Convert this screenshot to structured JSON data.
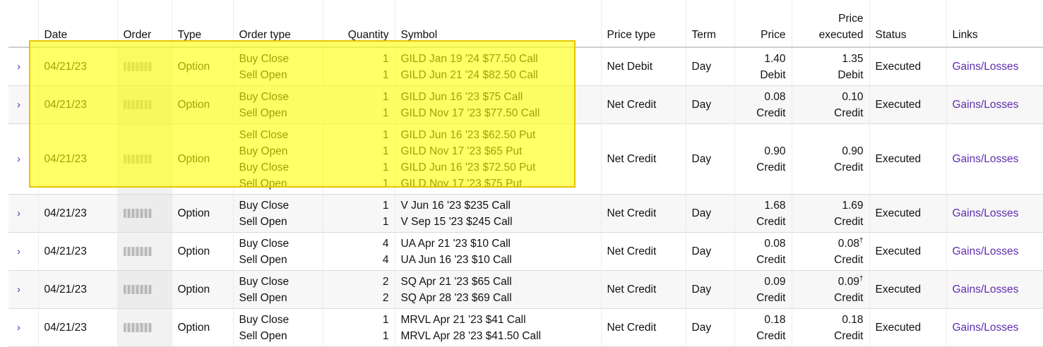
{
  "columns": {
    "date": "Date",
    "order": "Order",
    "type": "Type",
    "order_type": "Order type",
    "quantity": "Quantity",
    "symbol": "Symbol",
    "price_type": "Price type",
    "term": "Term",
    "price": "Price",
    "price_executed_1": "Price",
    "price_executed_2": "executed",
    "status": "Status",
    "links": "Links"
  },
  "expand_glyph": "›",
  "rows": [
    {
      "date": "04/21/23",
      "type": "Option",
      "legs": [
        {
          "order_type": "Buy Close",
          "qty": "1",
          "symbol": "GILD Jan 19 '24 $77.50 Call"
        },
        {
          "order_type": "Sell Open",
          "qty": "1",
          "symbol": "GILD Jun 21 '24 $82.50 Call"
        }
      ],
      "price_type": "Net Debit",
      "term": "Day",
      "price": "1.40",
      "price_unit": "Debit",
      "price_exec": "1.35",
      "price_exec_mark": "",
      "price_exec_unit": "Debit",
      "status": "Executed",
      "link": "Gains/Losses"
    },
    {
      "date": "04/21/23",
      "type": "Option",
      "legs": [
        {
          "order_type": "Buy Close",
          "qty": "1",
          "symbol": "GILD Jun 16 '23 $75 Call"
        },
        {
          "order_type": "Sell Open",
          "qty": "1",
          "symbol": "GILD Nov 17 '23 $77.50 Call"
        }
      ],
      "price_type": "Net Credit",
      "term": "Day",
      "price": "0.08",
      "price_unit": "Credit",
      "price_exec": "0.10",
      "price_exec_mark": "",
      "price_exec_unit": "Credit",
      "status": "Executed",
      "link": "Gains/Losses"
    },
    {
      "date": "04/21/23",
      "type": "Option",
      "legs": [
        {
          "order_type": "Sell Close",
          "qty": "1",
          "symbol": "GILD Jun 16 '23 $62.50 Put"
        },
        {
          "order_type": "Buy Open",
          "qty": "1",
          "symbol": "GILD Nov 17 '23 $65 Put"
        },
        {
          "order_type": "Buy Close",
          "qty": "1",
          "symbol": "GILD Jun 16 '23 $72.50 Put"
        },
        {
          "order_type": "Sell Open",
          "qty": "1",
          "symbol": "GILD Nov 17 '23 $75 Put"
        }
      ],
      "price_type": "Net Credit",
      "term": "Day",
      "price": "0.90",
      "price_unit": "Credit",
      "price_exec": "0.90",
      "price_exec_mark": "",
      "price_exec_unit": "Credit",
      "status": "Executed",
      "link": "Gains/Losses"
    },
    {
      "date": "04/21/23",
      "type": "Option",
      "legs": [
        {
          "order_type": "Buy Close",
          "qty": "1",
          "symbol": "V Jun 16 '23 $235 Call"
        },
        {
          "order_type": "Sell Open",
          "qty": "1",
          "symbol": "V Sep 15 '23 $245 Call"
        }
      ],
      "price_type": "Net Credit",
      "term": "Day",
      "price": "1.68",
      "price_unit": "Credit",
      "price_exec": "1.69",
      "price_exec_mark": "",
      "price_exec_unit": "Credit",
      "status": "Executed",
      "link": "Gains/Losses"
    },
    {
      "date": "04/21/23",
      "type": "Option",
      "legs": [
        {
          "order_type": "Buy Close",
          "qty": "4",
          "symbol": "UA Apr 21 '23 $10 Call"
        },
        {
          "order_type": "Sell Open",
          "qty": "4",
          "symbol": "UA Jun 16 '23 $10 Call"
        }
      ],
      "price_type": "Net Credit",
      "term": "Day",
      "price": "0.08",
      "price_unit": "Credit",
      "price_exec": "0.08",
      "price_exec_mark": "†",
      "price_exec_unit": "Credit",
      "status": "Executed",
      "link": "Gains/Losses"
    },
    {
      "date": "04/21/23",
      "type": "Option",
      "legs": [
        {
          "order_type": "Buy Close",
          "qty": "2",
          "symbol": "SQ Apr 21 '23 $65 Call"
        },
        {
          "order_type": "Sell Open",
          "qty": "2",
          "symbol": "SQ Apr 28 '23 $69 Call"
        }
      ],
      "price_type": "Net Credit",
      "term": "Day",
      "price": "0.09",
      "price_unit": "Credit",
      "price_exec": "0.09",
      "price_exec_mark": "†",
      "price_exec_unit": "Credit",
      "status": "Executed",
      "link": "Gains/Losses"
    },
    {
      "date": "04/21/23",
      "type": "Option",
      "legs": [
        {
          "order_type": "Buy Close",
          "qty": "1",
          "symbol": "MRVL Apr 21 '23 $41 Call"
        },
        {
          "order_type": "Sell Open",
          "qty": "1",
          "symbol": "MRVL Apr 28 '23 $41.50 Call"
        }
      ],
      "price_type": "Net Credit",
      "term": "Day",
      "price": "0.18",
      "price_unit": "Credit",
      "price_exec": "0.18",
      "price_exec_mark": "",
      "price_exec_unit": "Credit",
      "status": "Executed",
      "link": "Gains/Losses"
    }
  ]
}
